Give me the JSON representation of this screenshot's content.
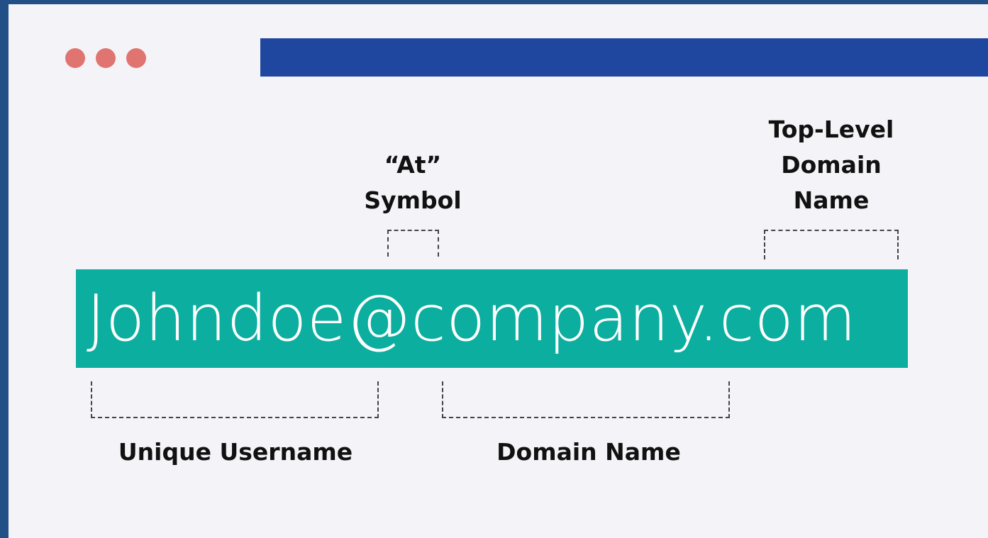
{
  "window": {
    "dots": [
      "red-dot",
      "red-dot",
      "red-dot"
    ],
    "bar_color": "#1f47a0",
    "dot_color": "#e07470"
  },
  "email": {
    "text": "Johndoe@company.com",
    "box_color": "#0bae9f"
  },
  "labels": {
    "at_symbol": [
      "“At”",
      "Symbol"
    ],
    "tld": [
      "Top-Level",
      "Domain",
      "Name"
    ],
    "username": "Unique Username",
    "domain": "Domain Name"
  }
}
